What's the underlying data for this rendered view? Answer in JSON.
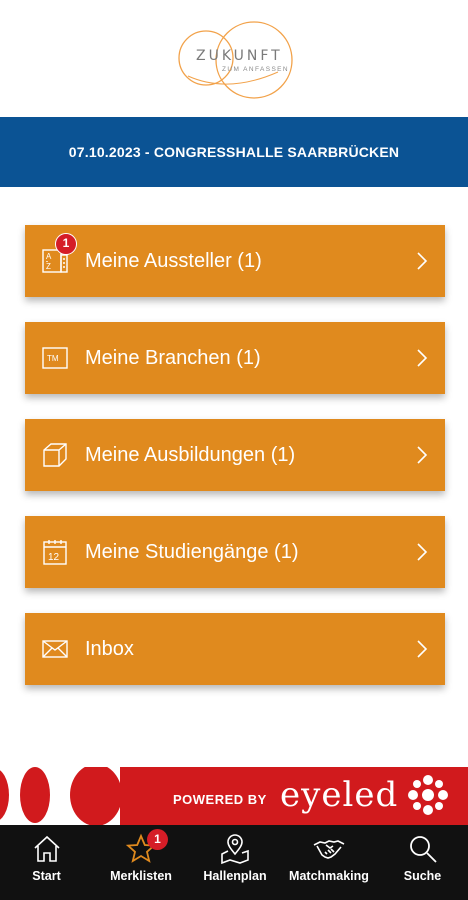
{
  "logo": {
    "line1": "ZUKUNFT",
    "line2": "ZUM ANFASSEN",
    "ring_color": "#f2a24a"
  },
  "banner": {
    "text": "07.10.2023 - CONGRESSHALLE SAARBRÜCKEN",
    "background": "#0b5394"
  },
  "menu": {
    "accent": "#e08a1e",
    "items": [
      {
        "label": "Meine Aussteller (1)",
        "icon": "a-z-list-icon",
        "badge": "1"
      },
      {
        "label": "Meine Branchen (1)",
        "icon": "trademark-icon"
      },
      {
        "label": "Meine Ausbildungen (1)",
        "icon": "cube-icon"
      },
      {
        "label": "Meine Studiengänge (1)",
        "icon": "calendar-icon",
        "calendar_day": "12"
      },
      {
        "label": "Inbox",
        "icon": "envelope-icon"
      }
    ]
  },
  "powered": {
    "prefix": "POWERED BY",
    "brand": "eyeled",
    "background": "#d11a1d"
  },
  "nav": {
    "items": [
      {
        "label": "Start",
        "icon": "home-icon"
      },
      {
        "label": "Merklisten",
        "icon": "star-icon",
        "badge": "1",
        "icon_color": "#e08a1e"
      },
      {
        "label": "Hallenplan",
        "icon": "map-pin-icon"
      },
      {
        "label": "Matchmaking",
        "icon": "handshake-icon"
      },
      {
        "label": "Suche",
        "icon": "search-icon"
      }
    ]
  }
}
